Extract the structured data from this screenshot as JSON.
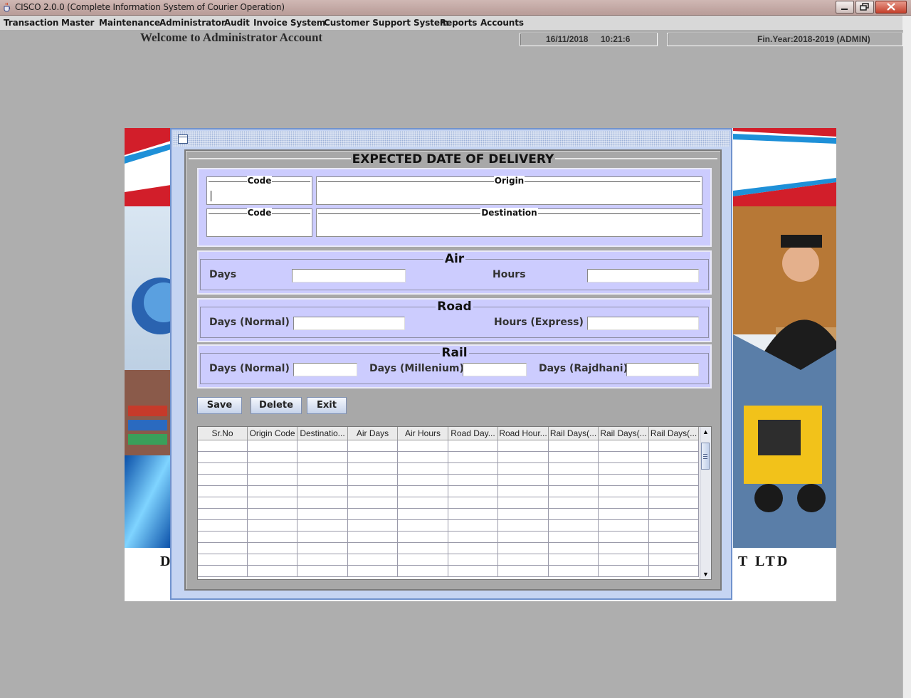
{
  "window": {
    "title": "CISCO 2.0.0 (Complete Information System of Courier Operation)",
    "icon": "java-cup-icon"
  },
  "menu": [
    {
      "label": "Transaction"
    },
    {
      "label": "Master"
    },
    {
      "label": "Maintenance"
    },
    {
      "label": "Administrator"
    },
    {
      "label": "Audit"
    },
    {
      "label": "Invoice System"
    },
    {
      "label": "Customer Support System"
    },
    {
      "label": "Reports"
    },
    {
      "label": "Accounts"
    }
  ],
  "header": {
    "welcome": "Welcome to Administrator Account",
    "date": "16/11/2018",
    "time": "10:21:6",
    "fin_year": "Fin.Year:2018-2019  (ADMIN)"
  },
  "background": {
    "left_letter": "D",
    "right_text": "T  LTD"
  },
  "form": {
    "title": "EXPECTED DATE OF DELIVERY",
    "origin_code_label": "Code",
    "origin_label": "Origin",
    "dest_code_label": "Code",
    "destination_label": "Destination",
    "origin_code_value": "",
    "origin_value": "",
    "dest_code_value": "",
    "destination_value": "",
    "air": {
      "title": "Air",
      "days_label": "Days",
      "hours_label": "Hours",
      "days_value": "",
      "hours_value": ""
    },
    "road": {
      "title": "Road",
      "days_label": "Days (Normal)",
      "hours_label": "Hours (Express)",
      "days_value": "",
      "hours_value": ""
    },
    "rail": {
      "title": "Rail",
      "normal_label": "Days (Normal)",
      "millenium_label": "Days (Millenium)",
      "rajdhani_label": "Days (Rajdhani)",
      "normal_value": "",
      "millenium_value": "",
      "rajdhani_value": ""
    },
    "buttons": {
      "save": "Save",
      "delete": "Delete",
      "exit": "Exit"
    }
  },
  "table": {
    "columns": [
      "Sr.No",
      "Origin Code",
      "Destinatio...",
      "Air Days",
      "Air Hours",
      "Road Day...",
      "Road Hour...",
      "Rail Days(...",
      "Rail Days(...",
      "Rail Days(..."
    ],
    "empty_rows": 12
  },
  "colors": {
    "accent_red": "#d21e2a",
    "accent_blue": "#1e90d8",
    "panel_lavender": "#ccccfe",
    "frame_blue": "#7092cd"
  }
}
